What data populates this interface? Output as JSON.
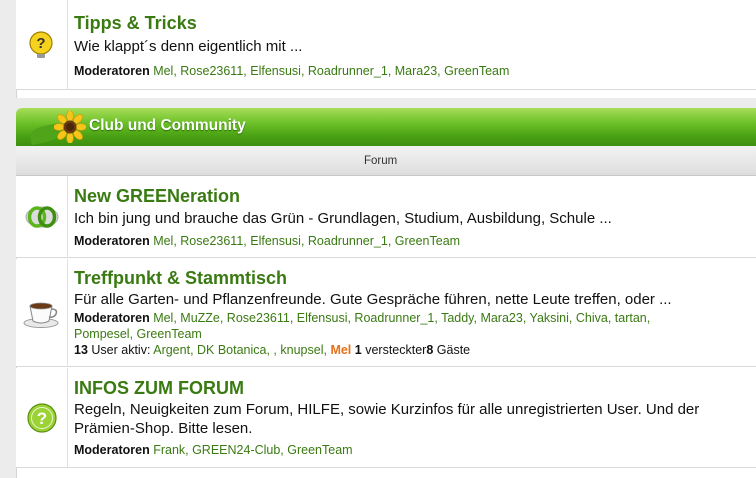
{
  "rows": [
    {
      "title": "Tipps & Tricks",
      "desc": "Wie klappt´s denn eigentlich mit ...",
      "mods_label": "Moderatoren",
      "mods": "Mel, Rose23611, Elfensusi, Roadrunner_1, Mara23, GreenTeam",
      "icon": "question-icon"
    },
    {
      "title": "New GREENeration",
      "desc": "Ich bin jung und brauche das Grün - Grundlagen, Studium, Ausbildung, Schule ...",
      "mods_label": "Moderatoren",
      "mods": "Mel, Rose23611, Elfensusi, Roadrunner_1, GreenTeam",
      "icon": "rings-icon"
    },
    {
      "title": "Treffpunkt & Stammtisch",
      "desc": "Für alle Garten- und Pflanzenfreunde. Gute Gespräche führen, nette Leute treffen, oder ...",
      "mods_label": "Moderatoren",
      "mods_line1": "Mel, MuZZe, Rose23611, Elfensusi, Roadrunner_1, Taddy, Mara23, Yaksini, Chiva, tartan,",
      "mods_line2": "Pompesel, GreenTeam",
      "active_count": "13",
      "active_label": "User aktiv:",
      "active_users": "Argent, DK Botanica, , knupsel,",
      "active_hot": "Mel",
      "hidden_count": "1",
      "hidden_label": "versteckter",
      "guests_count": "8",
      "guests_label": "Gäste",
      "icon": "coffee-cup-icon"
    },
    {
      "title": "INFOS ZUM FORUM",
      "desc": "Regeln, Neuigkeiten zum Forum, HILFE, sowie Kurzinfos für alle unregistrierten User. Und der Prämien-Shop. Bitte lesen.",
      "mods_label": "Moderatoren",
      "mods": "Frank, GREEN24-Club, GreenTeam",
      "icon": "help-circle-icon"
    }
  ],
  "category": {
    "title": "Club und Community",
    "icon": "sunflower-icon",
    "column_header": "Forum"
  },
  "colors": {
    "link_green": "#3a7a12",
    "header_green": "#5db81e",
    "highlight_orange": "#e8701a"
  }
}
